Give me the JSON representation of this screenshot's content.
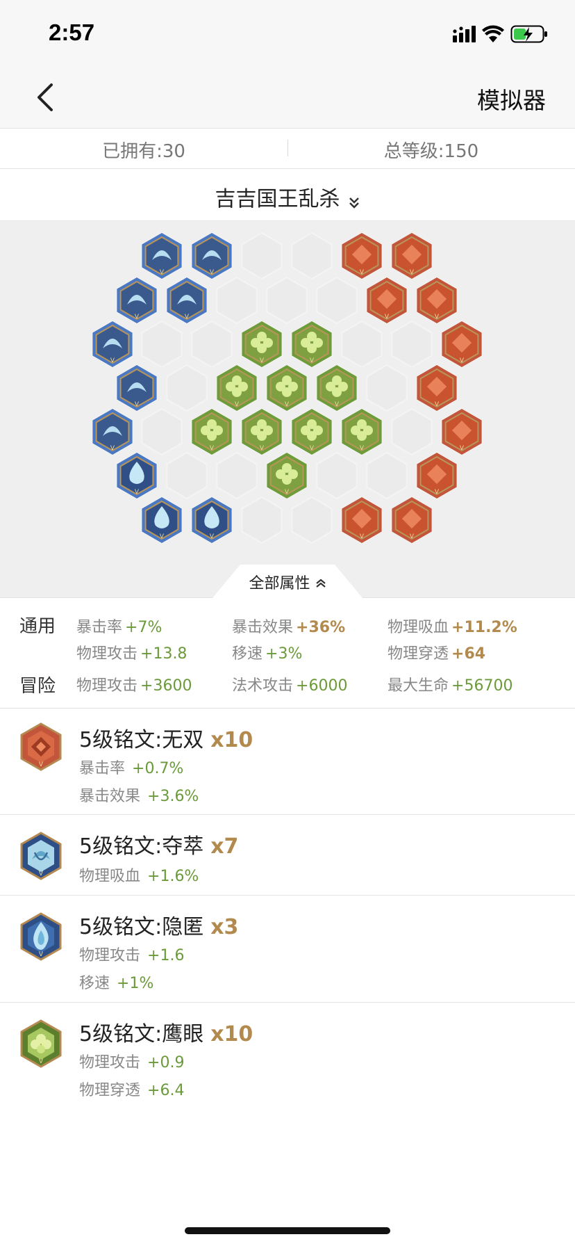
{
  "status_bar": {
    "time": "2:57"
  },
  "nav": {
    "simulator_label": "模拟器"
  },
  "summary": {
    "owned": "已拥有:30",
    "total_level": "总等级:150"
  },
  "page_name": "吉吉国王乱杀",
  "all_attributes_label": "全部属性",
  "attributes": {
    "general_label": "通用",
    "general": [
      {
        "name": "暴击率",
        "value": "+7%",
        "highlight": false
      },
      {
        "name": "暴击效果",
        "value": "+36%",
        "highlight": true
      },
      {
        "name": "物理吸血",
        "value": "+11.2%",
        "highlight": true
      },
      {
        "name": "物理攻击",
        "value": "+13.8",
        "highlight": false
      },
      {
        "name": "移速",
        "value": "+3%",
        "highlight": false
      },
      {
        "name": "物理穿透",
        "value": "+64",
        "highlight": true
      }
    ],
    "adventure_label": "冒险",
    "adventure": [
      {
        "name": "物理攻击",
        "value": "+3600"
      },
      {
        "name": "法术攻击",
        "value": "+6000"
      },
      {
        "name": "最大生命",
        "value": "+56700"
      }
    ]
  },
  "runes": [
    {
      "icon": "red-rune-icon",
      "name": "5级铭文:无双",
      "count": "x10",
      "stats": [
        {
          "name": "暴击率",
          "value": "+0.7%"
        },
        {
          "name": "暴击效果",
          "value": "+3.6%"
        }
      ]
    },
    {
      "icon": "blue-knot-rune-icon",
      "name": "5级铭文:夺萃",
      "count": "x7",
      "stats": [
        {
          "name": "物理吸血",
          "value": "+1.6%"
        }
      ]
    },
    {
      "icon": "blue-flame-rune-icon",
      "name": "5级铭文:隐匿",
      "count": "x3",
      "stats": [
        {
          "name": "物理攻击",
          "value": "+1.6"
        },
        {
          "name": "移速",
          "value": "+1%"
        }
      ]
    },
    {
      "icon": "green-clover-rune-icon",
      "name": "5级铭文:鹰眼",
      "count": "x10",
      "stats": [
        {
          "name": "物理攻击",
          "value": "+0.9"
        },
        {
          "name": "物理穿透",
          "value": "+6.4"
        }
      ]
    }
  ],
  "colors": {
    "blue_rune": "#4a78c2",
    "red_rune": "#c2553a",
    "green_rune": "#6f9c3a",
    "gold_value": "#b38a4d",
    "green_value": "#6b9a3a"
  }
}
